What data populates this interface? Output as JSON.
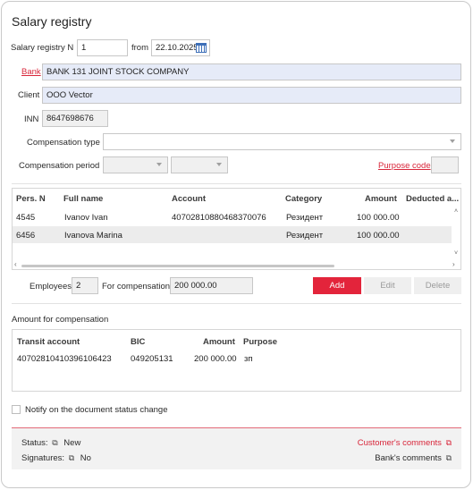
{
  "title": "Salary registry",
  "registry": {
    "number_label": "Salary registry N",
    "number": "1",
    "from_label": "from",
    "date": "22.10.2025"
  },
  "bank": {
    "label": "Bank",
    "value": "BANK 131 JOINT STOCK COMPANY"
  },
  "client": {
    "label": "Client",
    "value": "OOO Vector"
  },
  "inn": {
    "label": "INN",
    "value": "8647698676"
  },
  "compensation_type": {
    "label": "Compensation type",
    "value": ""
  },
  "compensation_period": {
    "label": "Compensation period",
    "purpose_code_label": "Purpose code"
  },
  "employees_table": {
    "headers": {
      "pers": "Pers. N",
      "name": "Full name",
      "account": "Account",
      "category": "Category",
      "amount": "Amount",
      "deducted": "Deducted a..."
    },
    "rows": [
      {
        "pers": "4545",
        "name": "Ivanov Ivan",
        "account": "40702810880468370076",
        "category": "Резидент",
        "amount": "100 000.00",
        "deducted": ""
      },
      {
        "pers": "6456",
        "name": "Ivanova Marina",
        "account": "",
        "category": "Резидент",
        "amount": "100 000.00",
        "deducted": ""
      }
    ]
  },
  "totals": {
    "employees_label": "Employees",
    "employees": "2",
    "compensation_label": "For compensation",
    "compensation": "200 000.00"
  },
  "actions": {
    "add": "Add",
    "edit": "Edit",
    "delete": "Delete"
  },
  "amount_section": {
    "title": "Amount for compensation",
    "headers": {
      "transit": "Transit account",
      "bic": "BIC",
      "amount": "Amount",
      "purpose": "Purpose"
    },
    "rows": [
      {
        "transit": "40702810410396106423",
        "bic": "049205131",
        "amount": "200 000.00",
        "purpose": "зп"
      }
    ]
  },
  "notify_label": "Notify on the document status change",
  "footer": {
    "status_label": "Status:",
    "status_value": "New",
    "signatures_label": "Signatures:",
    "signatures_value": "No",
    "customer_comments": "Customer's comments",
    "bank_comments": "Bank's comments"
  },
  "colors": {
    "accent": "#e3243b",
    "field_highlight": "#e6ebf8"
  },
  "icons": [
    "calendar-icon",
    "chevron-down-icon",
    "external-window-icon",
    "checkbox"
  ]
}
